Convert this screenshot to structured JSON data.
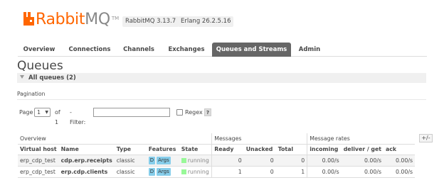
{
  "header": {
    "logo_rabbit": "Rabbit",
    "logo_mq": "MQ",
    "logo_tm": "TM",
    "rabbitmq_version": "RabbitMQ 3.13.7",
    "erlang_version": "Erlang 26.2.5.16",
    "brand_color": "#ff6600"
  },
  "tabs": [
    {
      "label": "Overview"
    },
    {
      "label": "Connections"
    },
    {
      "label": "Channels"
    },
    {
      "label": "Exchanges"
    },
    {
      "label": "Queues and Streams",
      "active": true
    },
    {
      "label": "Admin"
    }
  ],
  "page_title": "Queues",
  "section": {
    "title": "All queues (2)"
  },
  "pagination": {
    "title": "Pagination",
    "page_label": "Page",
    "page_value": "1",
    "of_label": "of 1",
    "filter_label": "- Filter:",
    "filter_value": "",
    "regex_label": "Regex",
    "help_label": "?"
  },
  "table": {
    "groups": [
      "Overview",
      "Messages",
      "Message rates"
    ],
    "toggle_label": "+/-",
    "columns": [
      "Virtual host",
      "Name",
      "Type",
      "Features",
      "State",
      "Ready",
      "Unacked",
      "Total",
      "incoming",
      "deliver / get",
      "ack"
    ],
    "rows": [
      {
        "vhost": "erp_cdp_test",
        "name": "cdp.erp.receipts",
        "type": "classic",
        "features": [
          "D",
          "Args"
        ],
        "state": "running",
        "ready": "0",
        "unacked": "0",
        "total": "0",
        "incoming": "0.00/s",
        "deliver_get": "0.00/s",
        "ack": "0.00/s"
      },
      {
        "vhost": "erp_cdp_test",
        "name": "erp.cdp.clients",
        "type": "classic",
        "features": [
          "D",
          "Args"
        ],
        "state": "running",
        "ready": "1",
        "unacked": "0",
        "total": "1",
        "incoming": "0.00/s",
        "deliver_get": "0.00/s",
        "ack": "0.00/s"
      }
    ]
  }
}
